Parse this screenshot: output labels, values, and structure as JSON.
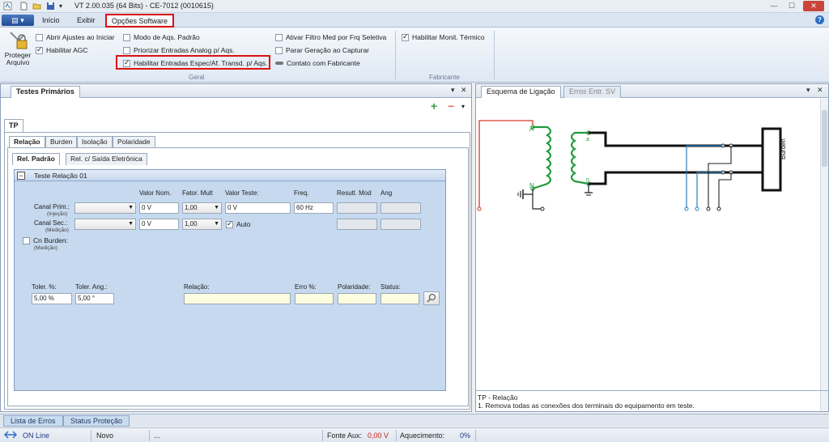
{
  "app": {
    "title": "VT 2.00.035 (64 Bits) - CE-7012 (0010615)"
  },
  "window": {
    "minimize": "—",
    "maximize": "☐",
    "close": "✕"
  },
  "ribbon": {
    "tabs": [
      "Início",
      "Exibir",
      "Opções Software"
    ],
    "help": "?",
    "protect_label_1": "Proteger",
    "protect_label_2": "Arquivo",
    "items": {
      "abrir_ajustes": "Abrir Ajustes ao Iniciar",
      "habilitar_agc": "Habilitar AGC",
      "modo_aqs": "Modo de Aqs. Padrão",
      "priorizar": "Priorizar Entradas Analog p/ Aqs.",
      "habilitar_entradas": "Habilitar Entradas Espec/Af. Transd. p/ Aqs.",
      "ativar_filtro": "Ativar Filtro Med por Frq Seletiva",
      "parar_geracao": "Parar Geração ao Capturar",
      "contato": "Contato com Fabricante",
      "monit_termico": "Habilitar Monit. Térmico"
    },
    "groups": {
      "geral": "Geral",
      "fabricante": "Fabricante"
    }
  },
  "left_panel": {
    "title": "Testes Primários",
    "add": "+",
    "remove": "−",
    "menu": "▾",
    "pin": "▾",
    "close": "✕",
    "main_tab": "TP",
    "tabs": [
      "Relação",
      "Burden",
      "Isolação",
      "Polaridade"
    ],
    "subtabs": [
      "Rel. Padrão",
      "Rel. c/ Saída Eletrônica"
    ],
    "group_title": "Teste Relação 01",
    "group_toggle": "−",
    "headers": {
      "valor_nom": "Valor Nom.",
      "fator_mult": "Fator. Mult",
      "valor_teste": "Valor Teste:",
      "freq": "Freq.",
      "result_mod": "Resutl. Mod",
      "ang": "Ang"
    },
    "canal_prim": "Canal Prim.:",
    "canal_prim_sub": "(Injeção)",
    "canal_sec": "Canal Sec.:",
    "canal_sec_sub": "(Medição)",
    "cn_burden": "Cn Burden:",
    "cn_burden_sub": "(Medição)",
    "prim_valor_nom": "0 V",
    "prim_fator": "1,00",
    "prim_valor_teste": "0 V",
    "freq_value": "60 Hz",
    "sec_valor_nom": "0 V",
    "sec_fator": "1,00",
    "auto": "Auto",
    "bottom": {
      "toler_pct": "Toler. %:",
      "toler_ang": "Toler. Ang.:",
      "relacao": "Relação:",
      "erro": "Erro %:",
      "polaridade": "Polaridade:",
      "status": "Status:",
      "toler_pct_value": "5,00 %",
      "toler_ang_value": "5,00 °"
    }
  },
  "right_panel": {
    "tabs": [
      "Esquema de Ligação",
      "Erros Entr. SV"
    ],
    "pin": "▾",
    "close": "✕",
    "diagram": {
      "label_A": "A",
      "label_N": "N",
      "label_a": "a",
      "label_n": "n",
      "burden": "Burden"
    },
    "info_title": "TP - Relação",
    "info_text": "1. Remova todas as conexões dos terminais do equipamento em teste."
  },
  "bottom_tabs": [
    "Lista de Erros",
    "Status Proteção"
  ],
  "status": {
    "online": "ON Line",
    "mode": "Novo",
    "dots": "...",
    "fonte_label": "Fonte Aux:",
    "fonte_value": "0,00 V",
    "aquec_label": "Aquecimento:",
    "aquec_value": "0%"
  },
  "colors": {
    "highlight": "#dd1111",
    "coil": "#1f9a3a",
    "blue_wire": "#2a7fc1",
    "red_wire": "#d23a2a",
    "status_value": "#c21f1f"
  }
}
